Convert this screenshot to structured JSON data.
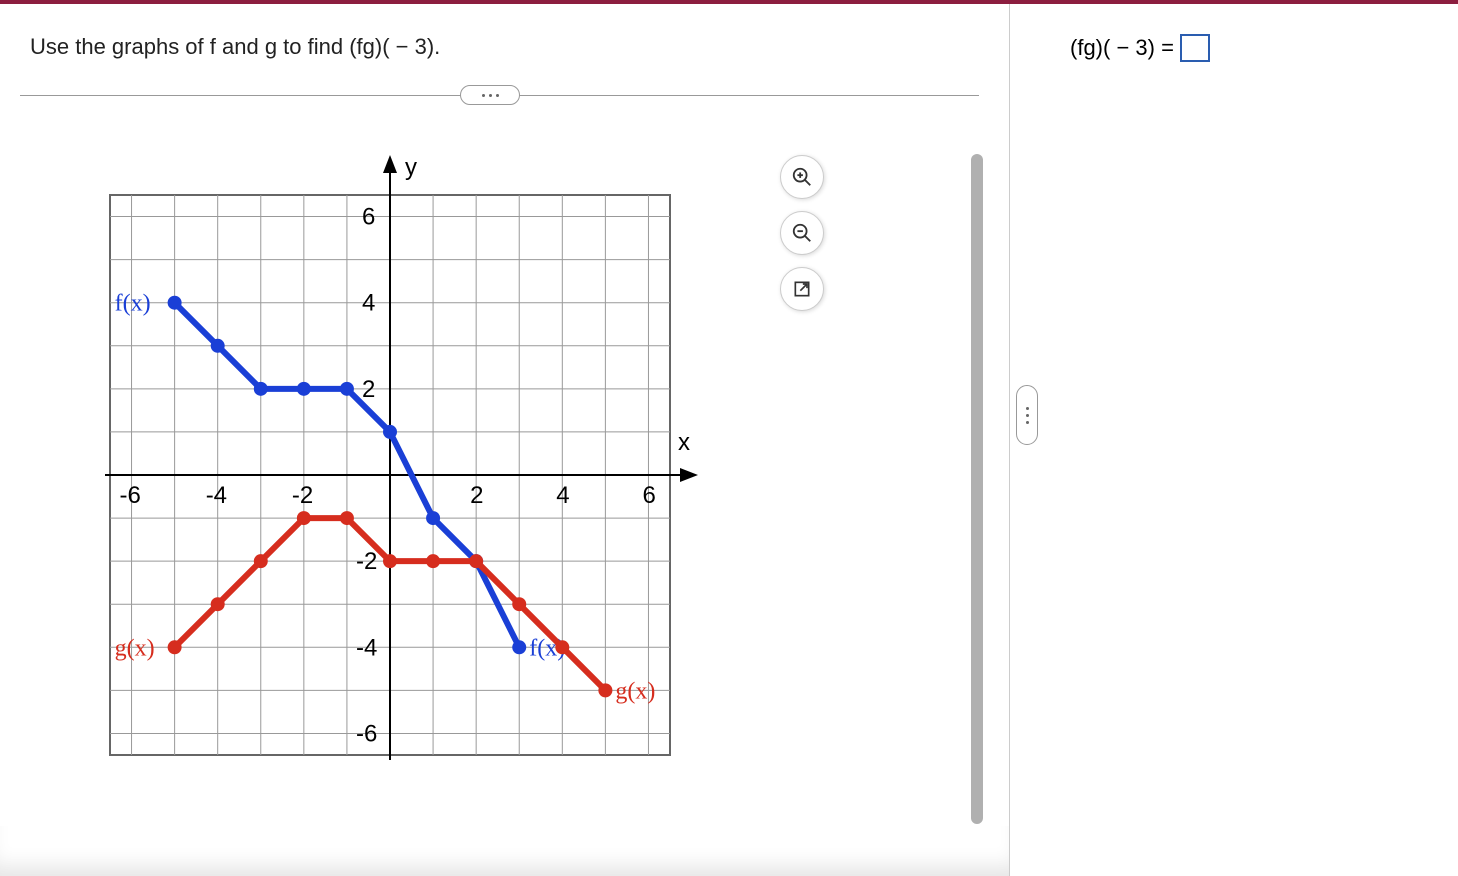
{
  "question": "Use the graphs of f and g to find (fg)( − 3).",
  "answer_prefix": "(fg)( − 3) =",
  "answer_value": "",
  "chart_data": {
    "type": "line",
    "xlabel": "x",
    "ylabel": "y",
    "xlim": [
      -6.5,
      6.5
    ],
    "ylim": [
      -6.5,
      6.5
    ],
    "x_ticks": [
      -6,
      -4,
      -2,
      2,
      4,
      6
    ],
    "y_ticks_pos": [
      2,
      4,
      6
    ],
    "y_ticks_neg": [
      -2,
      -4,
      -6
    ],
    "series": [
      {
        "name": "f(x)",
        "color": "#1a3fd6",
        "label_left": "f(x)",
        "label_right": "f(x)",
        "points": [
          {
            "x": -5,
            "y": 4
          },
          {
            "x": -4,
            "y": 3
          },
          {
            "x": -3,
            "y": 2
          },
          {
            "x": -2,
            "y": 2
          },
          {
            "x": -1,
            "y": 2
          },
          {
            "x": 0,
            "y": 1
          },
          {
            "x": 1,
            "y": -1
          },
          {
            "x": 2,
            "y": -2
          },
          {
            "x": 3,
            "y": -4
          }
        ]
      },
      {
        "name": "g(x)",
        "color": "#d62d1e",
        "label_left": "g(x)",
        "label_right": "g(x)",
        "points": [
          {
            "x": -5,
            "y": -4
          },
          {
            "x": -4,
            "y": -3
          },
          {
            "x": -3,
            "y": -2
          },
          {
            "x": -2,
            "y": -1
          },
          {
            "x": -1,
            "y": -1
          },
          {
            "x": 0,
            "y": -2
          },
          {
            "x": 1,
            "y": -2
          },
          {
            "x": 2,
            "y": -2
          },
          {
            "x": 3,
            "y": -3
          },
          {
            "x": 4,
            "y": -4
          },
          {
            "x": 5,
            "y": -5
          }
        ]
      }
    ]
  },
  "tools": {
    "zoom_in": "zoom-in",
    "zoom_out": "zoom-out",
    "popout": "open-new-window"
  }
}
